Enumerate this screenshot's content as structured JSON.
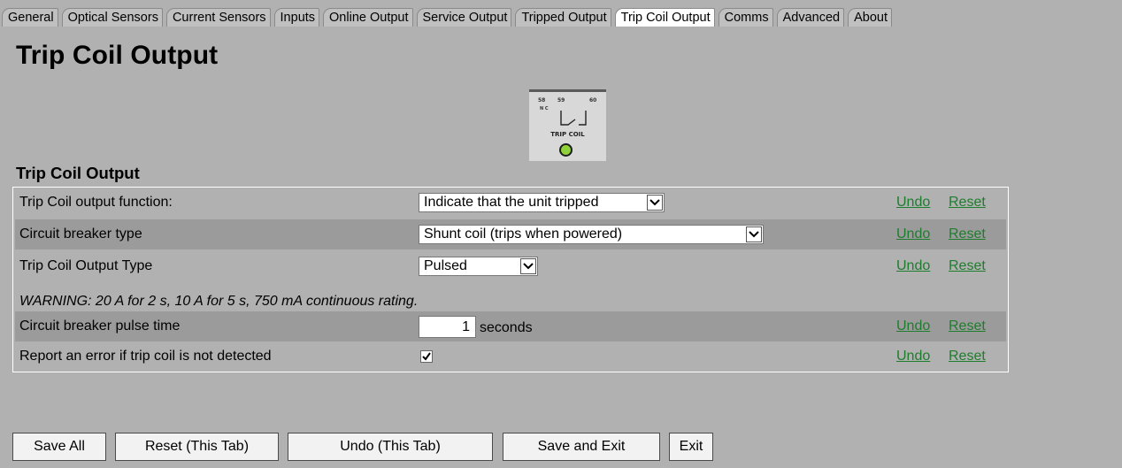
{
  "tabs": [
    {
      "label": "General"
    },
    {
      "label": "Optical Sensors"
    },
    {
      "label": "Current Sensors"
    },
    {
      "label": "Inputs"
    },
    {
      "label": "Online Output"
    },
    {
      "label": "Service Output"
    },
    {
      "label": "Tripped Output"
    },
    {
      "label": "Trip Coil Output",
      "active": true
    },
    {
      "label": "Comms"
    },
    {
      "label": "Advanced"
    },
    {
      "label": "About"
    }
  ],
  "page_title": "Trip Coil Output",
  "graphic": {
    "pins": [
      "58",
      "59",
      "60"
    ],
    "pin_sub": "N C",
    "label": "TRIP COIL",
    "led_color": "#8fd13a"
  },
  "section_title": "Trip Coil Output",
  "rows": {
    "function": {
      "label": "Trip Coil output function:",
      "value": "Indicate that the unit tripped",
      "undo": "Undo",
      "reset": "Reset"
    },
    "breaker_type": {
      "label": "Circuit breaker type",
      "value": "Shunt coil (trips when powered)",
      "undo": "Undo",
      "reset": "Reset"
    },
    "output_type": {
      "label": "Trip Coil Output Type",
      "value": "Pulsed",
      "undo": "Undo",
      "reset": "Reset"
    },
    "warning": "WARNING: 20 A for 2 s, 10 A for 5 s, 750 mA continuous rating.",
    "pulse_time": {
      "label": "Circuit breaker pulse time",
      "value": "1",
      "unit": "seconds",
      "undo": "Undo",
      "reset": "Reset"
    },
    "report_error": {
      "label": "Report an error if trip coil is not detected",
      "checked": true,
      "undo": "Undo",
      "reset": "Reset"
    }
  },
  "buttons": {
    "save_all": "Save All",
    "reset_tab": "Reset (This Tab)",
    "undo_tab": "Undo (This Tab)",
    "save_exit": "Save and Exit",
    "exit": "Exit"
  },
  "colors": {
    "background": "#b1b1b1",
    "row_dark": "#9b9b9b",
    "link": "#1e7d2d"
  }
}
